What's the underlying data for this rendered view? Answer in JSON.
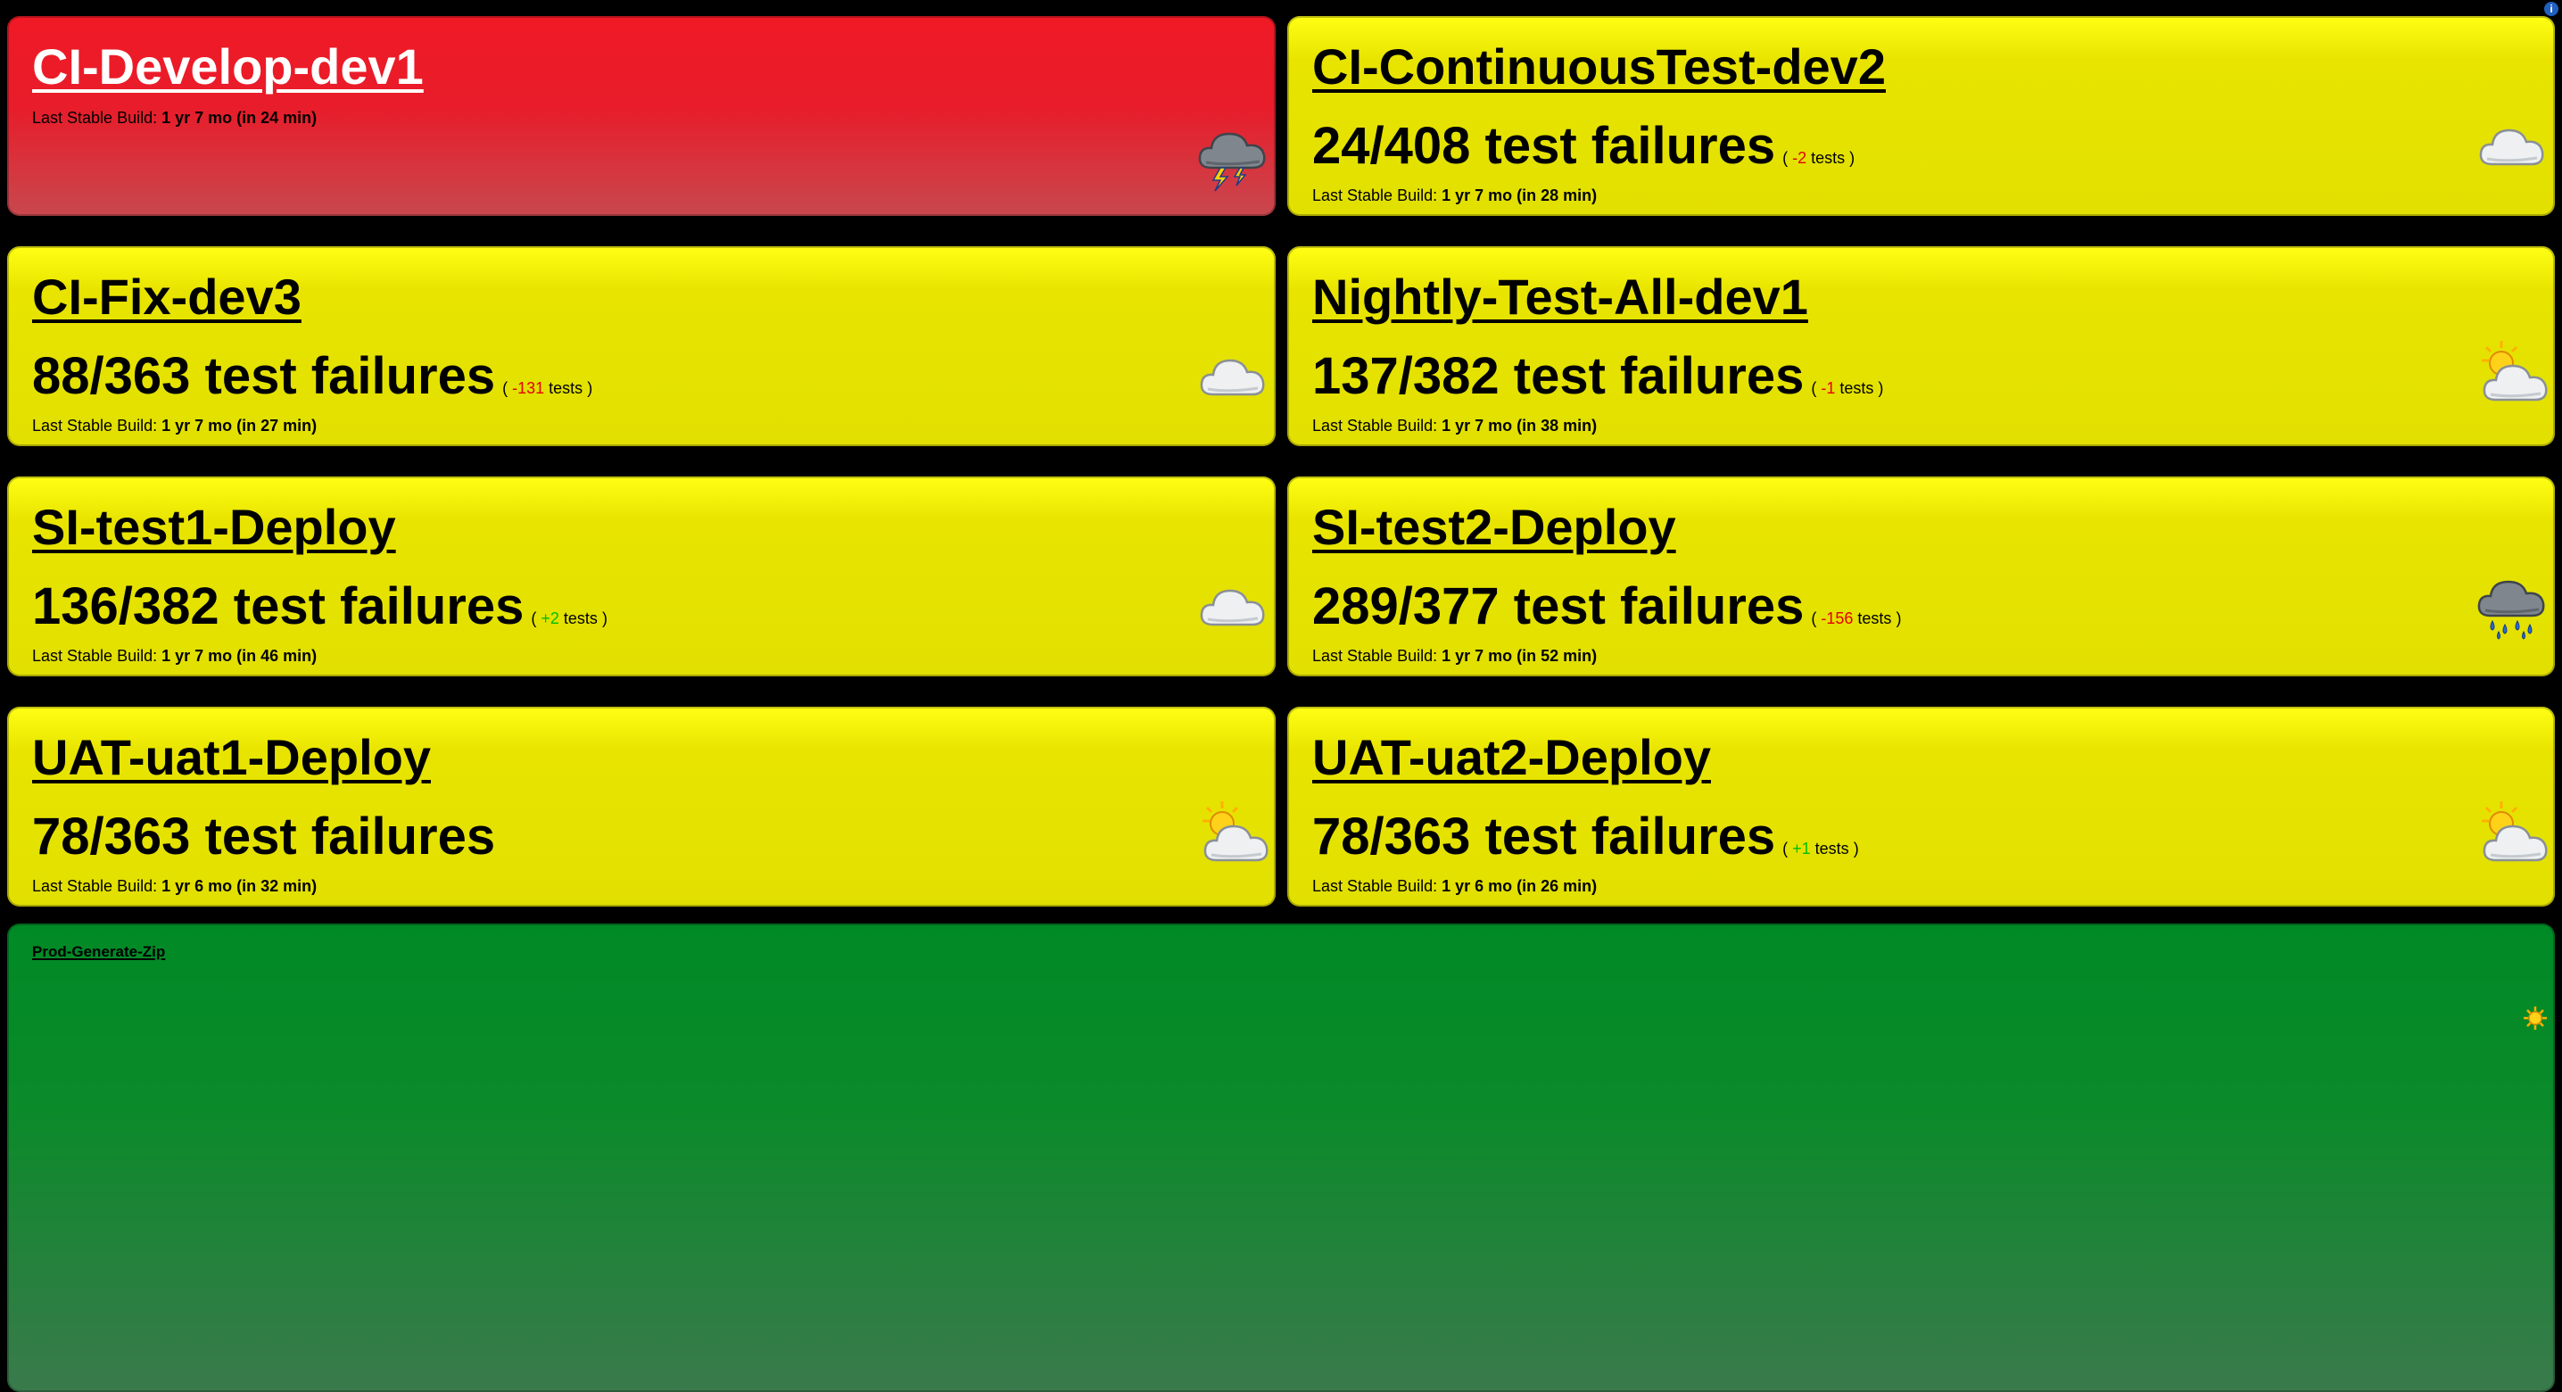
{
  "jobs": [
    {
      "name": "CI-Develop-dev1",
      "status": "red",
      "failures": "",
      "delta": "",
      "delta_sign": "",
      "last_label": "Last Stable Build:",
      "last_value": "1 yr 7 mo (in 24 min)",
      "weather": "thunderstorm-icon"
    },
    {
      "name": "CI-ContinuousTest-dev2",
      "status": "yellow",
      "failures": "24/408 test failures",
      "delta": "-2",
      "delta_sign": "neg",
      "last_label": "Last Stable Build:",
      "last_value": "1 yr 7 mo (in 28 min)",
      "weather": "cloudy-icon"
    },
    {
      "name": "CI-Fix-dev3",
      "status": "yellow",
      "failures": "88/363 test failures",
      "delta": "-131",
      "delta_sign": "neg",
      "last_label": "Last Stable Build:",
      "last_value": "1 yr 7 mo (in 27 min)",
      "weather": "cloudy-icon"
    },
    {
      "name": "Nightly-Test-All-dev1",
      "status": "yellow",
      "failures": "137/382 test failures",
      "delta": "-1",
      "delta_sign": "neg",
      "last_label": "Last Stable Build:",
      "last_value": "1 yr 7 mo (in 38 min)",
      "weather": "partly-sunny-icon"
    },
    {
      "name": "SI-test1-Deploy",
      "status": "yellow",
      "failures": "136/382 test failures",
      "delta": "+2",
      "delta_sign": "pos",
      "last_label": "Last Stable Build:",
      "last_value": "1 yr 7 mo (in 46 min)",
      "weather": "cloudy-icon"
    },
    {
      "name": "SI-test2-Deploy",
      "status": "yellow",
      "failures": "289/377 test failures",
      "delta": "-156",
      "delta_sign": "neg",
      "last_label": "Last Stable Build:",
      "last_value": "1 yr 7 mo (in 52 min)",
      "weather": "rain-icon"
    },
    {
      "name": "UAT-uat1-Deploy",
      "status": "yellow",
      "failures": "78/363 test failures",
      "delta": "",
      "delta_sign": "",
      "last_label": "Last Stable Build:",
      "last_value": "1 yr 6 mo (in 32 min)",
      "weather": "partly-sunny-icon"
    },
    {
      "name": "UAT-uat2-Deploy",
      "status": "yellow",
      "failures": "78/363 test failures",
      "delta": "+1",
      "delta_sign": "pos",
      "last_label": "Last Stable Build:",
      "last_value": "1 yr 6 mo (in 26 min)",
      "weather": "partly-sunny-icon"
    }
  ],
  "tests_word": "tests",
  "paren_open": "(",
  "paren_close": ")",
  "prod": {
    "name": "Prod-Generate-Zip",
    "status": "green",
    "weather": "sun-icon"
  },
  "corner_icon": "info-icon",
  "colors": {
    "yellow": "#e2e000",
    "red": "#e81c2a",
    "green": "#008a26",
    "delta_neg": "#e40000",
    "delta_pos": "#00c000"
  }
}
